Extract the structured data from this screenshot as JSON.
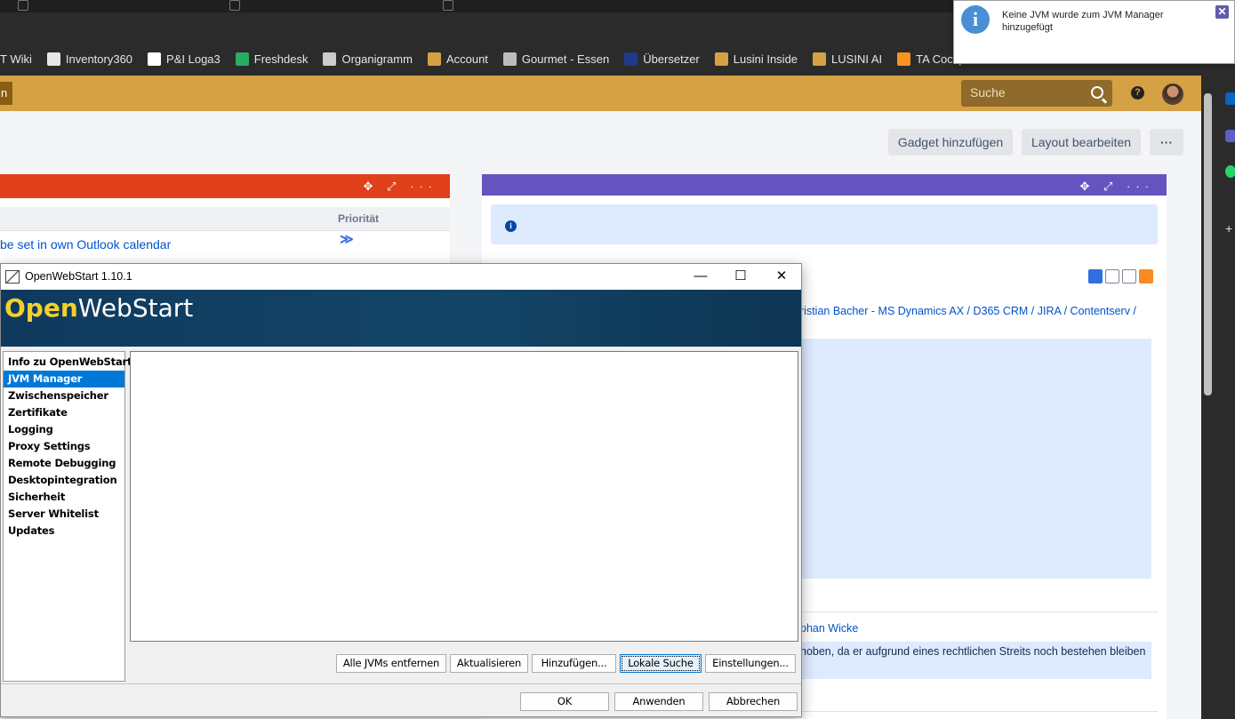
{
  "browser": {
    "bookmarks": [
      {
        "label": "T Wiki",
        "color": "#2b2b2b"
      },
      {
        "label": "Inventory360",
        "color": "#e6e6e6"
      },
      {
        "label": "P&I Loga3",
        "color": "#ffffff"
      },
      {
        "label": "Freshdesk",
        "color": "#27ae60"
      },
      {
        "label": "Organigramm",
        "color": "#cccccc"
      },
      {
        "label": "Account",
        "color": "#d4a145"
      },
      {
        "label": "Gourmet - Essen",
        "color": "#bbbbbb"
      },
      {
        "label": "Übersetzer",
        "color": "#1e3a8a"
      },
      {
        "label": "Lusini Inside",
        "color": "#d4a145"
      },
      {
        "label": "LUSINI AI",
        "color": "#d4a145"
      },
      {
        "label": "TA Cockpit",
        "color": "#f7931e"
      }
    ]
  },
  "jira": {
    "left_stub": "n",
    "search_placeholder": "Suche",
    "help_label": "?",
    "dashboard_buttons": {
      "add_gadget": "Gadget hinzufügen",
      "edit_layout": "Layout bearbeiten",
      "more": "···"
    },
    "gadget_left": {
      "controls": "✥ ⤢ ···",
      "col_priority": "Priorität",
      "row_link": "be set in own Outlook calendar",
      "row_priority_icon": "≫"
    },
    "gadget_right": {
      "controls": "✥ ⤢ ···",
      "info_icon": "i",
      "link1": "ristian Bacher - MS Dynamics AX / D365 CRM / JIRA / Contentserv /",
      "link2": "phan Wicke",
      "text": "hoben, da er aufgrund eines rechtlichen Streits noch bestehen bleiben"
    }
  },
  "notification": {
    "icon": "i",
    "message": "Keine JVM wurde zum JVM Manager hinzugefügt",
    "close": "✕"
  },
  "ows": {
    "title": "OpenWebStart 1.10.1",
    "logo_open": "Open",
    "logo_webstart": "WebStart",
    "controls": {
      "minimize": "—",
      "maximize": "☐",
      "close": "✕"
    },
    "nav": [
      "Info zu OpenWebStart",
      "JVM Manager",
      "Zwischenspeicher",
      "Zertifikate",
      "Logging",
      "Proxy Settings",
      "Remote Debugging",
      "Desktopintegration",
      "Sicherheit",
      "Server Whitelist",
      "Updates"
    ],
    "selected_nav": "JVM Manager",
    "buttons": {
      "remove_all": "Alle JVMs entfernen",
      "refresh": "Aktualisieren",
      "add": "Hinzufügen...",
      "local_search": "Lokale Suche",
      "settings": "Einstellungen..."
    },
    "footer": {
      "ok": "OK",
      "apply": "Anwenden",
      "cancel": "Abbrechen"
    }
  }
}
